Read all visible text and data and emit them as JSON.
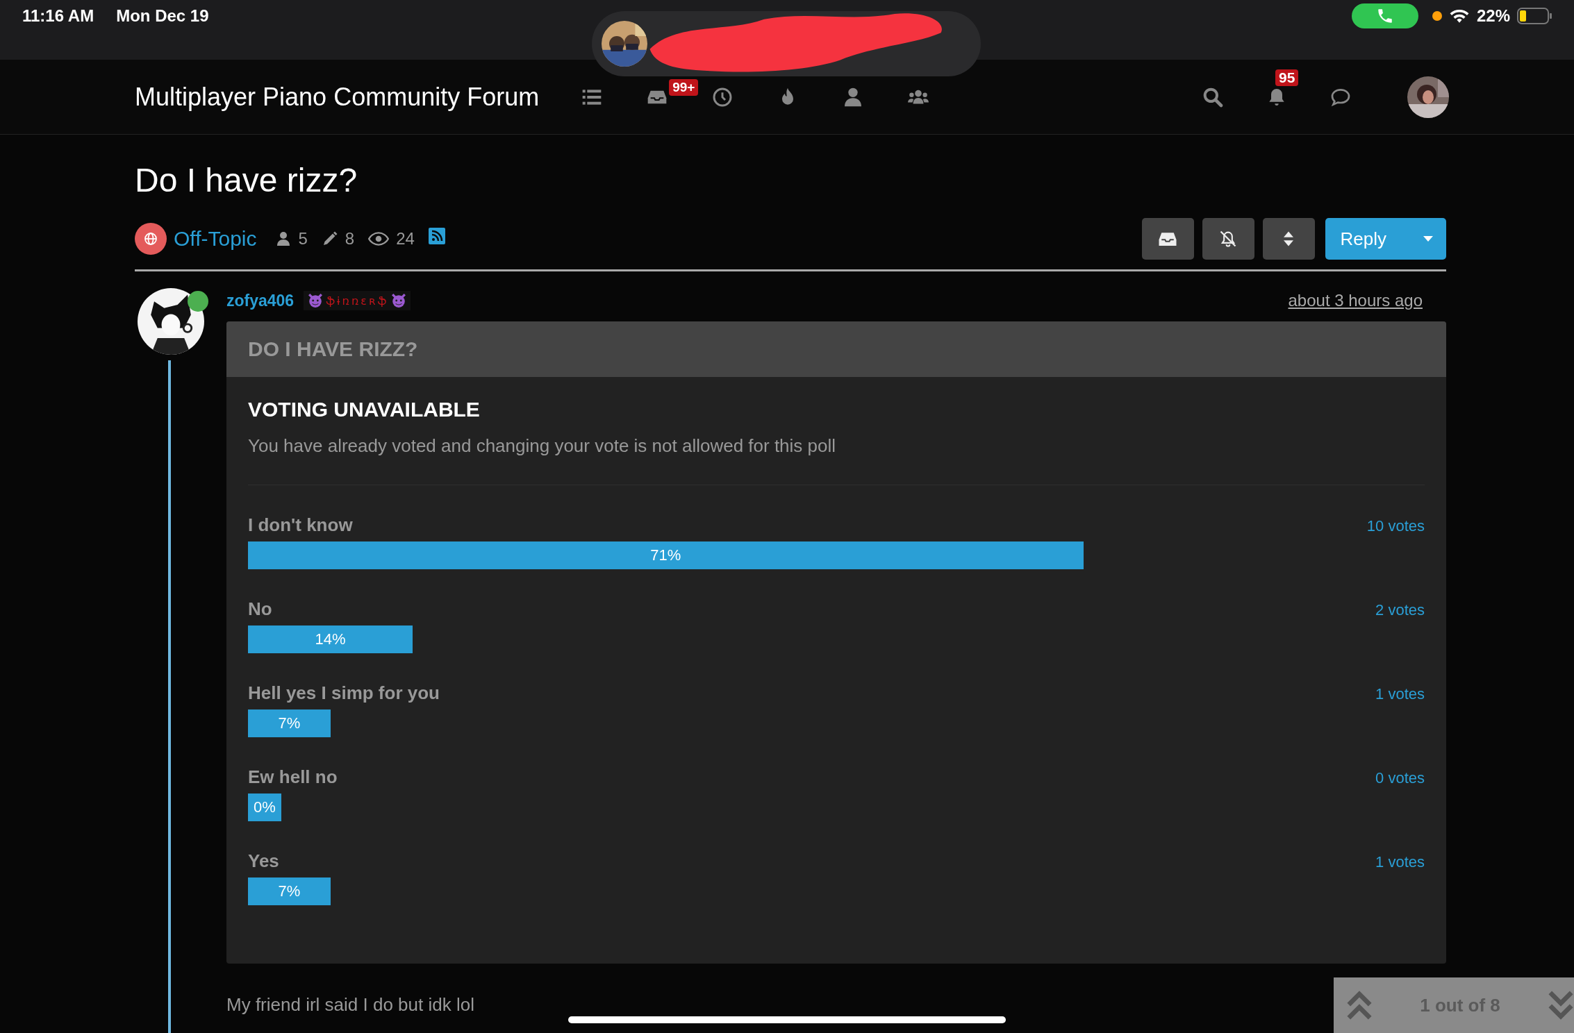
{
  "status_bar": {
    "time": "11:16 AM",
    "date": "Mon Dec 19",
    "call_active": true,
    "battery": "22%"
  },
  "navbar": {
    "site_title": "Multiplayer Piano Community Forum",
    "unread_badge": "99+",
    "notifications_badge": "95"
  },
  "topic": {
    "title": "Do I have rizz?",
    "category": "Off-Topic",
    "posters": "5",
    "posts": "8",
    "views": "24",
    "reply_button": "Reply"
  },
  "post": {
    "author": "zofya406",
    "author_online": true,
    "group_badge": "ֆɨռռɛʀֆ",
    "time": "about 3 hours ago",
    "poll": {
      "title": "DO I HAVE RIZZ?",
      "notice_title": "VOTING UNAVAILABLE",
      "notice_text": "You have already voted and changing your vote is not allowed for this poll",
      "options": [
        {
          "label": "I don't know",
          "votes": "10 votes",
          "percent": "71%"
        },
        {
          "label": "No",
          "votes": "2 votes",
          "percent": "14%"
        },
        {
          "label": "Hell yes I simp for you",
          "votes": "1 votes",
          "percent": "7%"
        },
        {
          "label": "Ew hell no",
          "votes": "0 votes",
          "percent": "0%"
        },
        {
          "label": "Yes",
          "votes": "1 votes",
          "percent": "7%"
        }
      ]
    },
    "body": "My friend irl said I do but idk lol"
  },
  "pager": {
    "text": "1 out of 8"
  }
}
